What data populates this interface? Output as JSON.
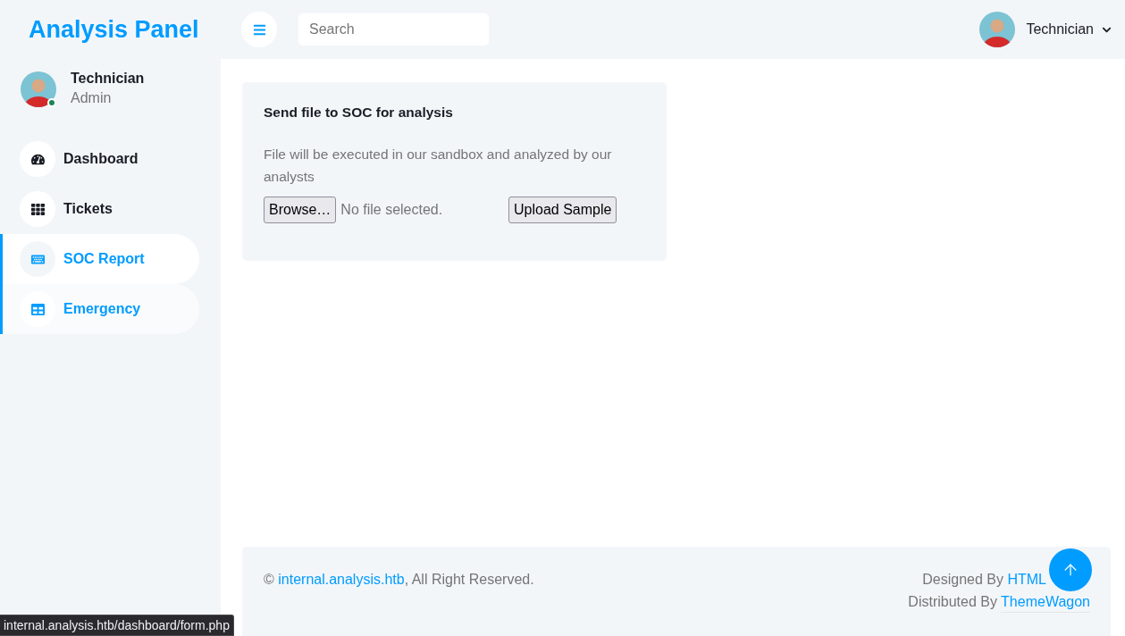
{
  "sidebar": {
    "brand": "Analysis Panel",
    "profile": {
      "name": "Technician",
      "role": "Admin",
      "online": true
    },
    "items": [
      {
        "label": "Dashboard",
        "selected": false,
        "hovered": false
      },
      {
        "label": "Tickets",
        "selected": false,
        "hovered": false
      },
      {
        "label": "SOC Report",
        "selected": true,
        "hovered": false
      },
      {
        "label": "Emergency",
        "selected": false,
        "hovered": true
      }
    ]
  },
  "topbar": {
    "search": {
      "placeholder": "Search"
    },
    "user": {
      "name": "Technician"
    }
  },
  "upload_card": {
    "title": "Send file to SOC for analysis",
    "description": "File will be executed in our sandbox and analyzed by our analysts",
    "browse_button": "Browse…",
    "file_status": "No file selected.",
    "submit_button": "Upload Sample"
  },
  "footer": {
    "copyright": {
      "symbol": "©",
      "link": "internal.analysis.htb",
      "rest": ", All Right Reserved."
    },
    "designed": {
      "text": "Designed By",
      "link": "HTML"
    },
    "distributed": {
      "text": "Distributed By",
      "link": "ThemeWagon"
    }
  },
  "status_bar": {
    "url": "internal.analysis.htb/dashboard/form.php"
  }
}
